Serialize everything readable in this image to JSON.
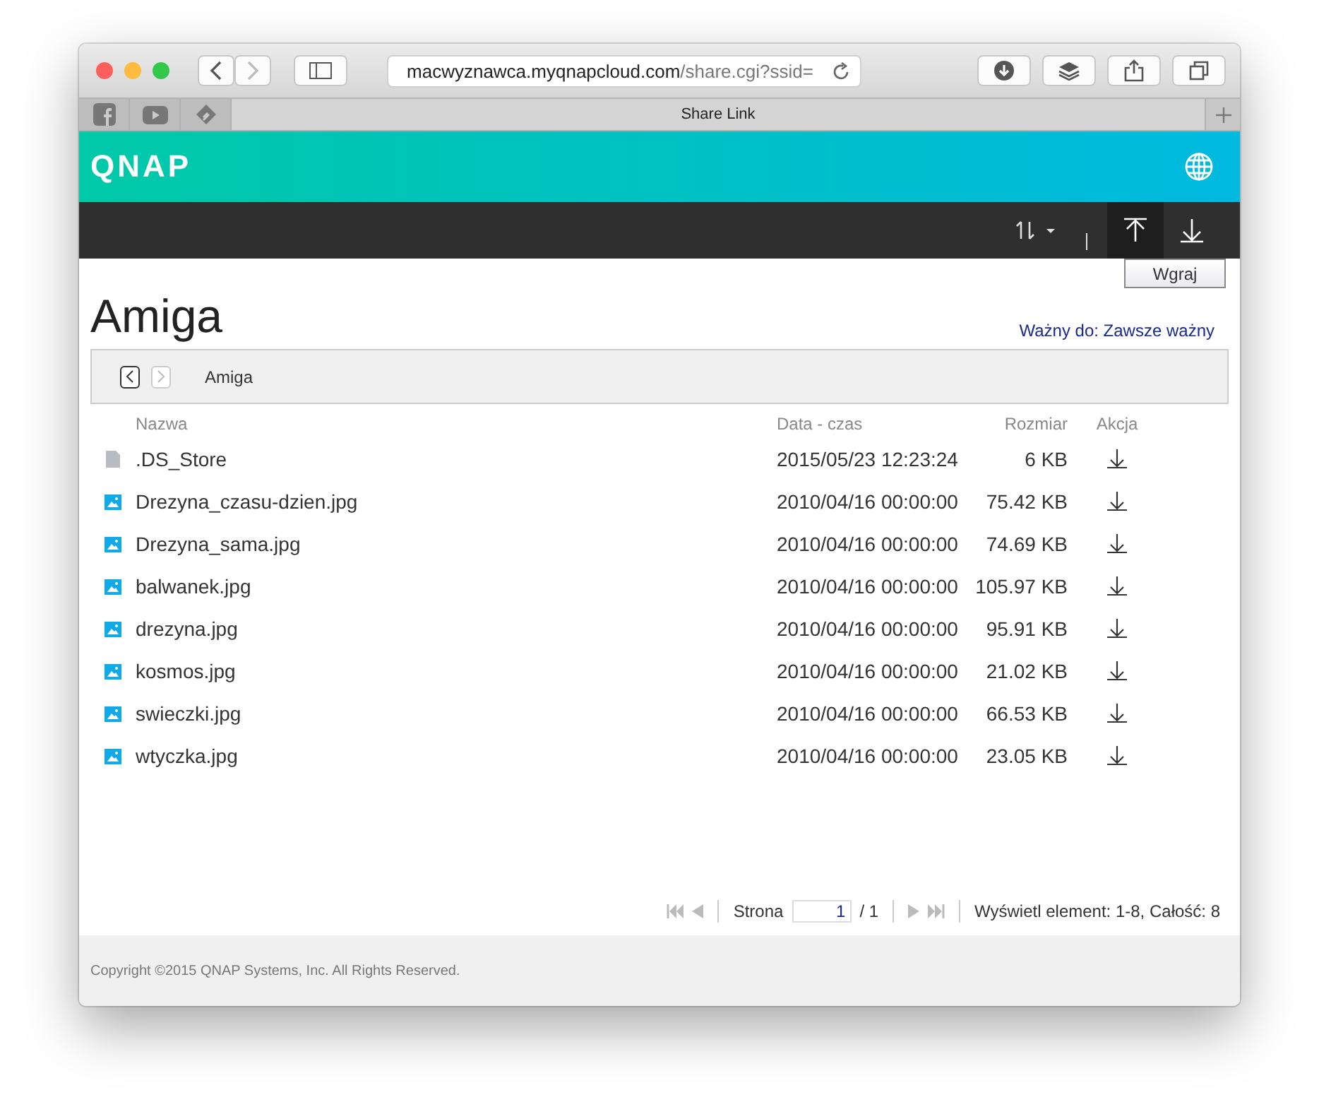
{
  "browser": {
    "url_host": "macwyznawca.myqnapcloud.com",
    "url_path": "/share.cgi?ssid=",
    "pinned_tabs": [
      {
        "kind": "facebook"
      },
      {
        "kind": "youtube"
      },
      {
        "kind": "feedly"
      }
    ],
    "tabs": [
      {
        "label": "Share Link",
        "selected": true
      }
    ]
  },
  "header": {
    "logo": "QNAP"
  },
  "toolbar": {
    "upload_tooltip": "Wgraj"
  },
  "page": {
    "title": "Amiga",
    "validity": "Ważny do: Zawsze ważny",
    "breadcrumb": "Amiga"
  },
  "table": {
    "columns": [
      "Nazwa",
      "Data - czas",
      "Rozmiar",
      "Akcja"
    ],
    "rows": [
      {
        "kind": "file",
        "name": ".DS_Store",
        "date": "2015/05/23 12:23:24",
        "size": "6 KB"
      },
      {
        "kind": "image",
        "name": "Drezyna_czasu-dzien.jpg",
        "date": "2010/04/16 00:00:00",
        "size": "75.42 KB"
      },
      {
        "kind": "image",
        "name": "Drezyna_sama.jpg",
        "date": "2010/04/16 00:00:00",
        "size": "74.69 KB"
      },
      {
        "kind": "image",
        "name": "balwanek.jpg",
        "date": "2010/04/16 00:00:00",
        "size": "105.97 KB"
      },
      {
        "kind": "image",
        "name": "drezyna.jpg",
        "date": "2010/04/16 00:00:00",
        "size": "95.91 KB"
      },
      {
        "kind": "image",
        "name": "kosmos.jpg",
        "date": "2010/04/16 00:00:00",
        "size": "21.02 KB"
      },
      {
        "kind": "image",
        "name": "swieczki.jpg",
        "date": "2010/04/16 00:00:00",
        "size": "66.53 KB"
      },
      {
        "kind": "image",
        "name": "wtyczka.jpg",
        "date": "2010/04/16 00:00:00",
        "size": "23.05 KB"
      }
    ]
  },
  "pager": {
    "page_label": "Strona",
    "page": "1",
    "total_pages": "/ 1",
    "summary": "Wyświetl element: 1-8, Całość: 8"
  },
  "footer": {
    "copyright": "Copyright ©2015 QNAP Systems, Inc. All Rights Reserved."
  }
}
